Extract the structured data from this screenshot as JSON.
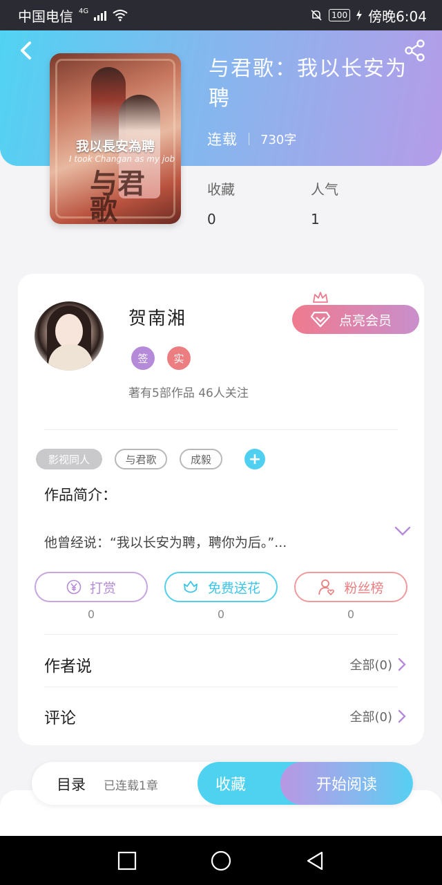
{
  "status_bar": {
    "carrier": "中国电信",
    "network": "4G",
    "battery": "100",
    "time": "傍晚6:04"
  },
  "header": {
    "back_icon": "chevron-left-icon",
    "share_icon": "share-icon"
  },
  "book": {
    "cover_title": "我以長安為聘",
    "cover_subtitle": "I took Changan as my job",
    "cover_big_text": "与君歌",
    "title": "与君歌：我以长安为聘",
    "status": "连载",
    "words": "730字",
    "stats": [
      {
        "label": "收藏",
        "value": "0"
      },
      {
        "label": "人气",
        "value": "1"
      }
    ]
  },
  "author": {
    "name": "贺南湘",
    "badges": [
      "签",
      "实"
    ],
    "stats_text": "著有5部作品 46人关注",
    "vip_button": "点亮会员"
  },
  "tags": [
    "影视同人",
    "与君歌",
    "成毅"
  ],
  "intro": {
    "label": "作品简介：",
    "text": "他曾经说：“我以长安为聘，聘你为后。”..."
  },
  "actions": [
    {
      "label": "打赏",
      "count": "0",
      "icon": "yuan-icon"
    },
    {
      "label": "免费送花",
      "count": "0",
      "icon": "flower-icon"
    },
    {
      "label": "粉丝榜",
      "count": "0",
      "icon": "user-heart-icon"
    }
  ],
  "sections": [
    {
      "title": "作者说",
      "link": "全部(0)"
    },
    {
      "title": "评论",
      "link": "全部(0)"
    }
  ],
  "bottom_bar": {
    "toc_label": "目录",
    "toc_status": "已连载1章",
    "favorite_label": "收藏",
    "read_label": "开始阅读"
  },
  "colors": {
    "accent_cyan": "#4fd2f0",
    "accent_purple": "#b58ad8",
    "accent_pink": "#ea7f82"
  }
}
